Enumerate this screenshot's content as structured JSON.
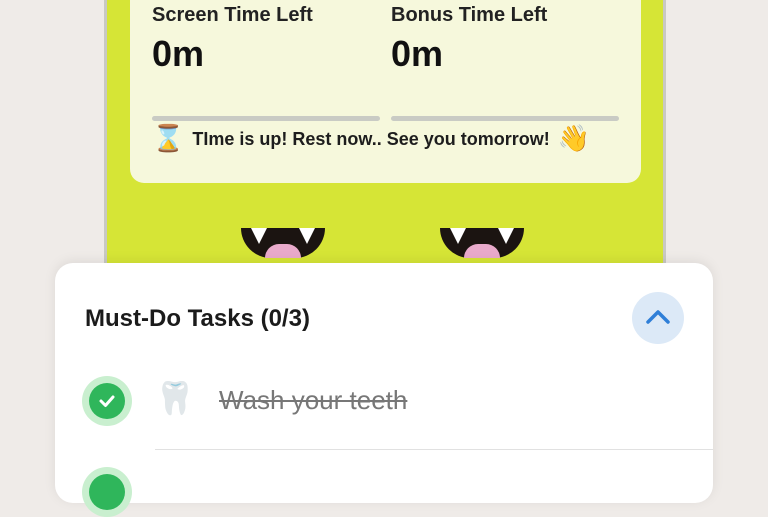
{
  "timer": {
    "screen_time_label": "Screen Time Left",
    "screen_time_value": "0m",
    "screen_time_progress": 0,
    "bonus_time_label": "Bonus Time Left",
    "bonus_time_value": "0m",
    "bonus_time_progress": 0,
    "message_icon": "⌛",
    "message": "TIme is up! Rest now.. See you tomorrow!",
    "message_emoji": "👋"
  },
  "tasks": {
    "title": "Must-Do Tasks (0/3)",
    "items": [
      {
        "icon": "🦷",
        "label": "Wash your teeth",
        "completed": true
      }
    ]
  },
  "colors": {
    "phone_background": "#d6e536",
    "check_green": "#2fb65b",
    "collapse_blue": "#2f7fd8"
  }
}
